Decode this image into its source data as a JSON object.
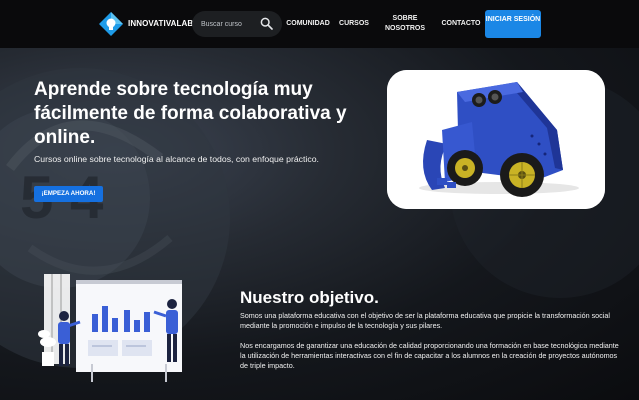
{
  "nav": {
    "brand": "INNOVATIVALAB",
    "search_placeholder": "Buscar curso",
    "links": [
      "COMUNIDAD",
      "CURSOS",
      "SOBRE NOSOTROS",
      "CONTACTO"
    ],
    "login_label": "INICIAR SESIÓN",
    "icons": {
      "logo": "diamond-bulb-logo",
      "search": "search-icon"
    }
  },
  "hero": {
    "title": "Aprende sobre tecnología muy fácilmente de forma colaborativa y online.",
    "subtitle": "Cursos online sobre tecnología al alcance de todos, con enfoque práctico.",
    "cta_label": "¡EMPEZA AHORA!"
  },
  "objective": {
    "title": "Nuestro objetivo.",
    "paragraph_1": "Somos una plataforma educativa con el objetivo de ser la plataforma educativa que propicie la transformación social mediante la promoción e impulso de la tecnología y sus pilares.",
    "paragraph_2": "Nos encargamos de garantizar una educación de calidad proporcionando una formación en base tecnológica mediante la utilización de herramientas interactivas con el fin de capacitar a los alumnos en la creación de proyectos autónomos de triple impacto."
  },
  "colors": {
    "nav_bg": "#0a0a0c",
    "primary_button": "#1b87e6",
    "cta_button": "#1570e0",
    "robot_blue": "#2f4fc4",
    "wheel_yellow": "#c9b325"
  }
}
